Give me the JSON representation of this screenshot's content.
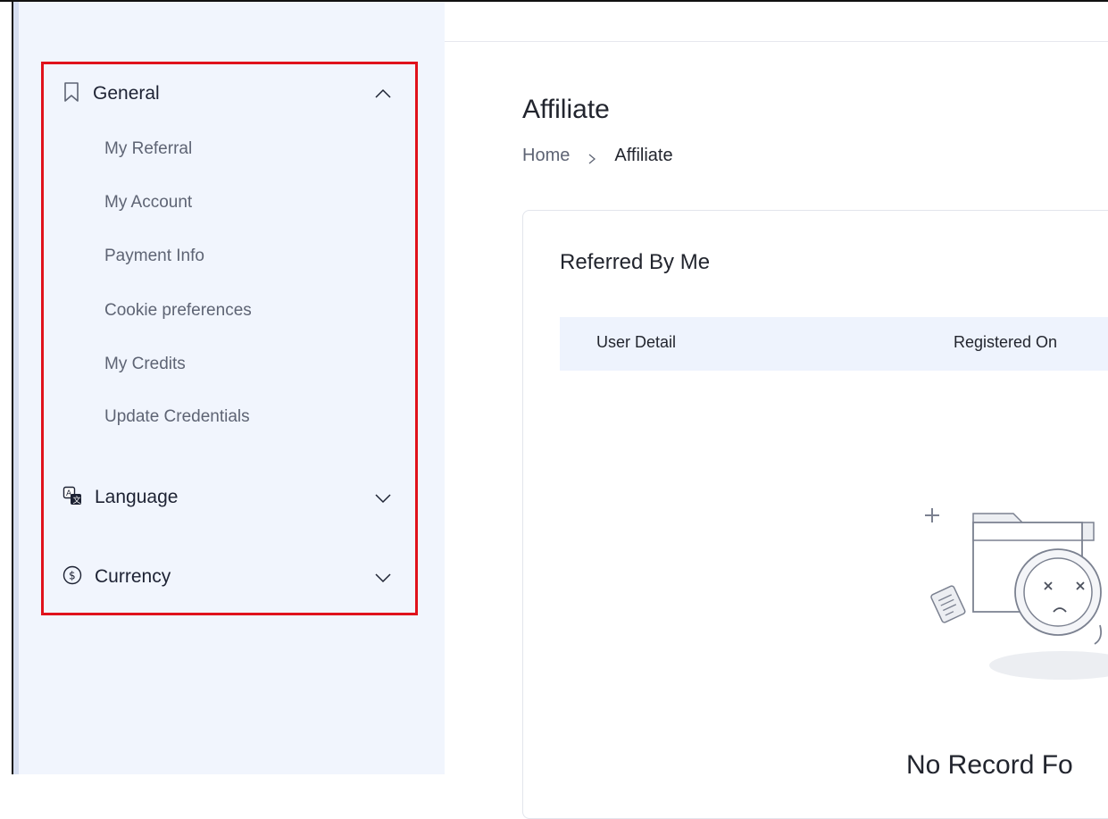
{
  "sidebar": {
    "general": {
      "label": "General",
      "icon": "bookmark-icon",
      "expanded": true,
      "items": [
        {
          "label": "My Referral"
        },
        {
          "label": "My Account"
        },
        {
          "label": "Payment Info"
        },
        {
          "label": "Cookie preferences"
        },
        {
          "label": "My Credits"
        },
        {
          "label": "Update Credentials"
        }
      ]
    },
    "language": {
      "label": "Language",
      "icon": "translate-icon",
      "expanded": false
    },
    "currency": {
      "label": "Currency",
      "icon": "dollar-icon",
      "expanded": false
    }
  },
  "main": {
    "title": "Affiliate",
    "breadcrumb": {
      "home": "Home",
      "current": "Affiliate"
    },
    "card": {
      "title": "Referred By Me",
      "columns": [
        "User Detail",
        "Registered On"
      ],
      "empty_text": "No Record Fo"
    }
  },
  "colors": {
    "highlight": "#e0121b",
    "sidebar_bg": "#f1f5fd",
    "table_head_bg": "#eef3fd"
  }
}
